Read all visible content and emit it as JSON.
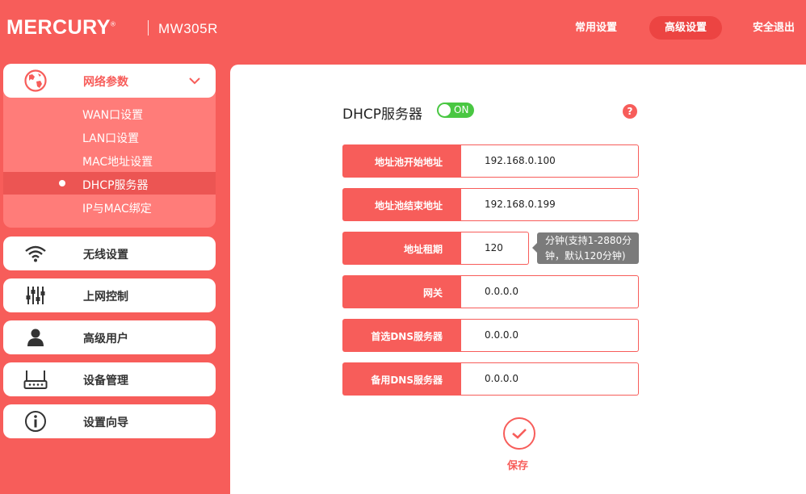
{
  "header": {
    "brand": "MERCURY",
    "brand_mark": "®",
    "model": "MW305R",
    "nav": [
      {
        "label": "常用设置",
        "active": false
      },
      {
        "label": "高级设置",
        "active": true
      },
      {
        "label": "安全退出",
        "active": false
      }
    ]
  },
  "sidebar": {
    "open_menu": {
      "label": "网络参数",
      "icon": "globe-icon",
      "expand_icon": "chevron-down-icon",
      "items": [
        {
          "label": "WAN口设置",
          "active": false
        },
        {
          "label": "LAN口设置",
          "active": false
        },
        {
          "label": "MAC地址设置",
          "active": false
        },
        {
          "label": "DHCP服务器",
          "active": true
        },
        {
          "label": "IP与MAC绑定",
          "active": false
        }
      ]
    },
    "menus": [
      {
        "label": "无线设置",
        "icon": "wifi-icon"
      },
      {
        "label": "上网控制",
        "icon": "sliders-icon"
      },
      {
        "label": "高级用户",
        "icon": "user-icon"
      },
      {
        "label": "设备管理",
        "icon": "router-icon"
      },
      {
        "label": "设置向导",
        "icon": "info-icon"
      }
    ]
  },
  "main": {
    "title": "DHCP服务器",
    "toggle": {
      "state": "ON"
    },
    "help": "?",
    "fields": [
      {
        "label": "地址池开始地址",
        "value": "192.168.0.100"
      },
      {
        "label": "地址池结束地址",
        "value": "192.168.0.199"
      },
      {
        "label": "地址租期",
        "value": "120"
      },
      {
        "label": "网关",
        "value": "0.0.0.0"
      },
      {
        "label": "首选DNS服务器",
        "value": "0.0.0.0"
      },
      {
        "label": "备用DNS服务器",
        "value": "0.0.0.0"
      }
    ],
    "lease_tip_line1": "分钟(支持1-2880分",
    "lease_tip_line2": "钟，默认120分钟)",
    "save_label": "保存"
  },
  "colors": {
    "accent": "#f75d5a",
    "active_bg": "#ec4442",
    "toggle_on": "#49c742"
  }
}
